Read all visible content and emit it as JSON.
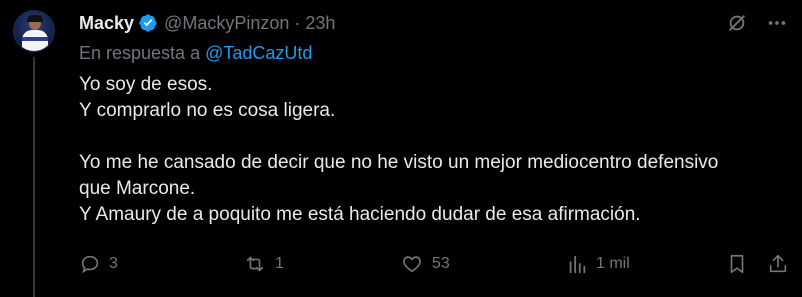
{
  "author": {
    "name": "Macky",
    "handle": "@MackyPinzon",
    "separator": "·",
    "time": "23h",
    "verified": true
  },
  "reply": {
    "prefix": "En respuesta a",
    "mention": "@TadCazUtd"
  },
  "body": {
    "lines": [
      "Yo soy de esos.",
      "Y comprarlo no es cosa ligera.",
      "",
      "Yo me he cansado de decir que no he visto un mejor mediocentro defensivo",
      "que Marcone.",
      "Y Amaury de a poquito me está haciendo dudar de esa afirmación."
    ]
  },
  "actions": {
    "replies": "3",
    "reposts": "1",
    "likes": "53",
    "views": "1 mil"
  },
  "icons": {
    "grok": "grok-icon",
    "more": "more-icon",
    "reply": "reply-icon",
    "repost": "repost-icon",
    "like": "heart-icon",
    "views": "views-icon",
    "bookmark": "bookmark-icon",
    "share": "share-icon"
  },
  "colors": {
    "background": "#000000",
    "text": "#e7e9ea",
    "secondary": "#71767b",
    "accent": "#1d9bf0"
  }
}
